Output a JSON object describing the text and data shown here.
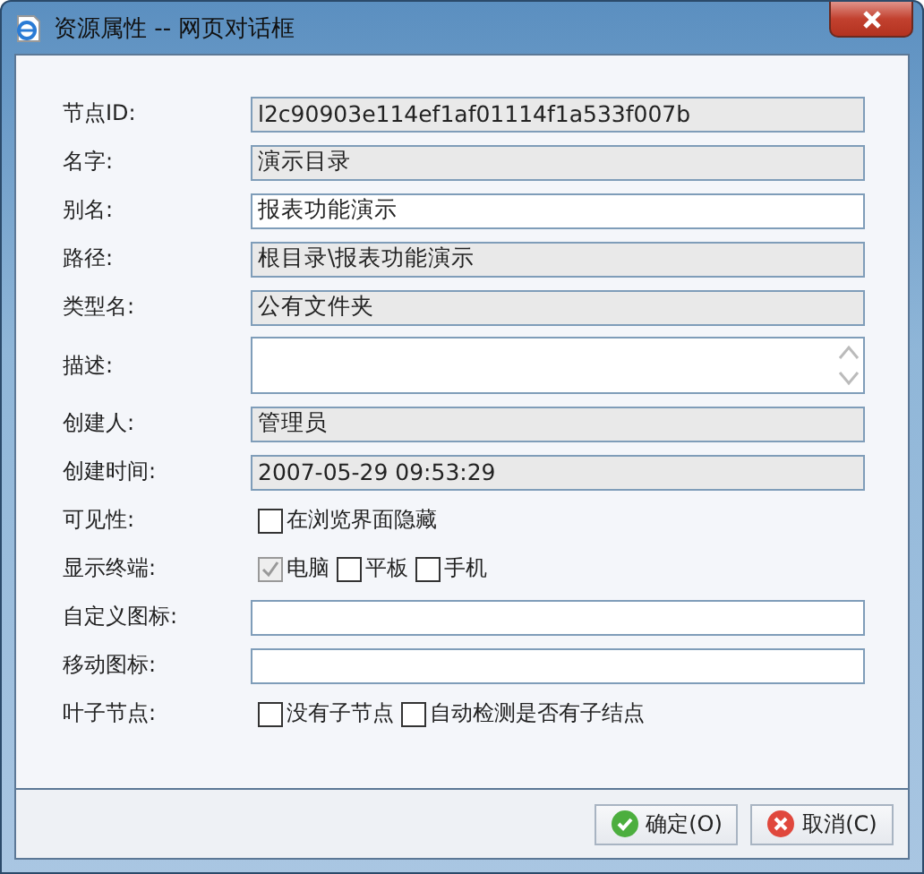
{
  "window": {
    "title": "资源属性 -- 网页对话框"
  },
  "fields": [
    {
      "label": "节点ID:",
      "kind": "text",
      "value": "l2c90903e114ef1af01114f1a533f007b",
      "readonly": true
    },
    {
      "label": "名字:",
      "kind": "text",
      "value": "演示目录",
      "readonly": true
    },
    {
      "label": "别名:",
      "kind": "text",
      "value": "报表功能演示",
      "readonly": false
    },
    {
      "label": "路径:",
      "kind": "text",
      "value": "根目录\\报表功能演示",
      "readonly": true
    },
    {
      "label": "类型名:",
      "kind": "text",
      "value": "公有文件夹",
      "readonly": true
    },
    {
      "label": "描述:",
      "kind": "textarea",
      "readonly": false
    },
    {
      "label": "创建人:",
      "kind": "text",
      "value": "管理员",
      "readonly": true
    },
    {
      "label": "创建时间:",
      "kind": "text",
      "value": "2007-05-29 09:53:29",
      "readonly": true
    },
    {
      "label": "可见性:",
      "kind": "checks",
      "options": [
        {
          "label": "在浏览界面隐藏",
          "checked": false,
          "disabled": false
        }
      ]
    },
    {
      "label": "显示终端:",
      "kind": "checks",
      "options": [
        {
          "label": "电脑",
          "checked": true,
          "disabled": true
        },
        {
          "label": "平板",
          "checked": false,
          "disabled": false
        },
        {
          "label": "手机",
          "checked": false,
          "disabled": false
        }
      ]
    },
    {
      "label": "自定义图标:",
      "kind": "text",
      "readonly": false
    },
    {
      "label": "移动图标:",
      "kind": "text",
      "readonly": false
    },
    {
      "label": "叶子节点:",
      "kind": "checks",
      "options": [
        {
          "label": "没有子节点",
          "checked": false,
          "disabled": false
        },
        {
          "label": "自动检测是否有子结点",
          "checked": false,
          "disabled": false
        }
      ]
    }
  ],
  "buttons": [
    {
      "label": "确定(O)",
      "kind": "ok"
    },
    {
      "label": "取消(C)",
      "kind": "cancel"
    }
  ]
}
